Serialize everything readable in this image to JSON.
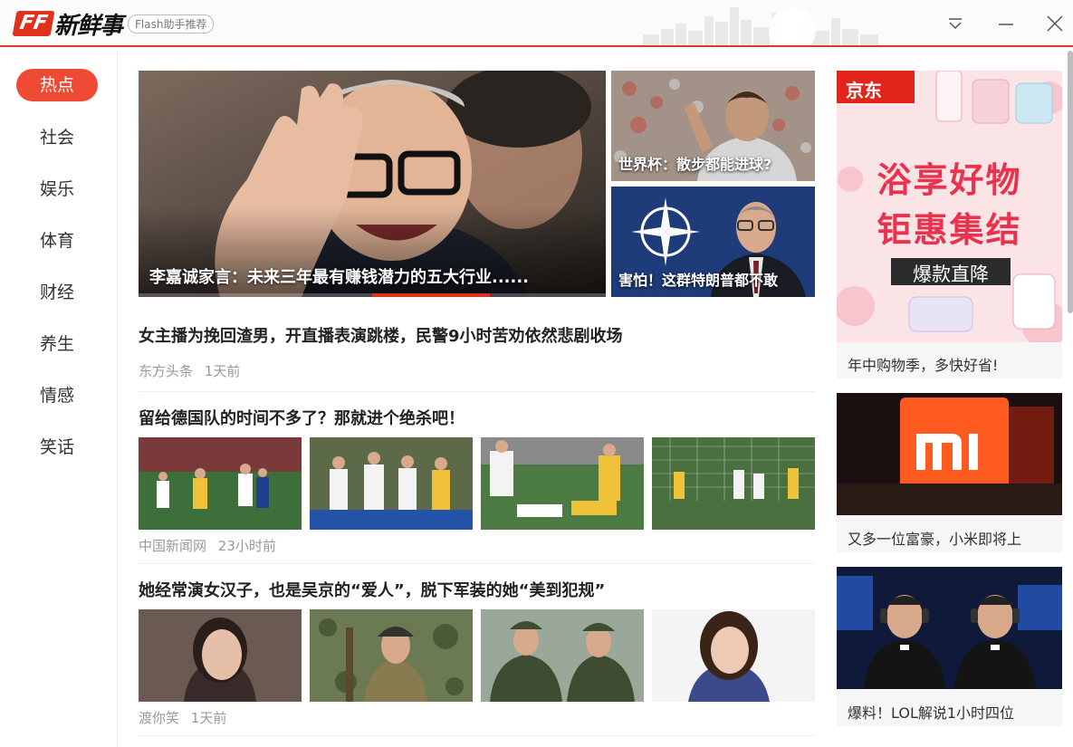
{
  "app": {
    "logo_mark": "FF",
    "logo_text": "新鲜事",
    "logo_tag": "Flash助手推荐",
    "brand_color": "#e0301e"
  },
  "window_controls": [
    {
      "name": "dropdown-icon"
    },
    {
      "name": "minimize-icon"
    },
    {
      "name": "close-icon"
    }
  ],
  "sidebar": {
    "items": [
      {
        "label": "热点",
        "active": true
      },
      {
        "label": "社会"
      },
      {
        "label": "娱乐"
      },
      {
        "label": "体育"
      },
      {
        "label": "财经"
      },
      {
        "label": "养生"
      },
      {
        "label": "情感"
      },
      {
        "label": "笑话"
      }
    ]
  },
  "hero": {
    "caption": "李嘉诚家言：未来三年最有赚钱潜力的五大行业......"
  },
  "side_features": [
    {
      "caption": "世界杯：散步都能进球?"
    },
    {
      "caption": "害怕！这群特朗普都不敢"
    }
  ],
  "articles": [
    {
      "title": "女主播为挽回渣男，开直播表演跳楼，民警9小时苦劝依然悲剧收场",
      "source": "东方头条",
      "time": "1天前"
    },
    {
      "title": "留给德国队的时间不多了？那就进个绝杀吧！",
      "source": "中国新闻网",
      "time": "23小时前"
    },
    {
      "title": "她经常演女汉子，也是吴京的“爱人”，脱下军装的她“美到犯规”",
      "source": "渡你笑",
      "time": "1天前"
    }
  ],
  "ads": [
    {
      "brand": "京东",
      "headline1": "浴享好物",
      "headline2": "钜惠集结",
      "badge": "爆款直降",
      "caption": "年中购物季，多快好省!"
    },
    {
      "caption": "又多一位富豪，小米即将上"
    },
    {
      "caption": "爆料！LOL解说1小时四位"
    }
  ]
}
